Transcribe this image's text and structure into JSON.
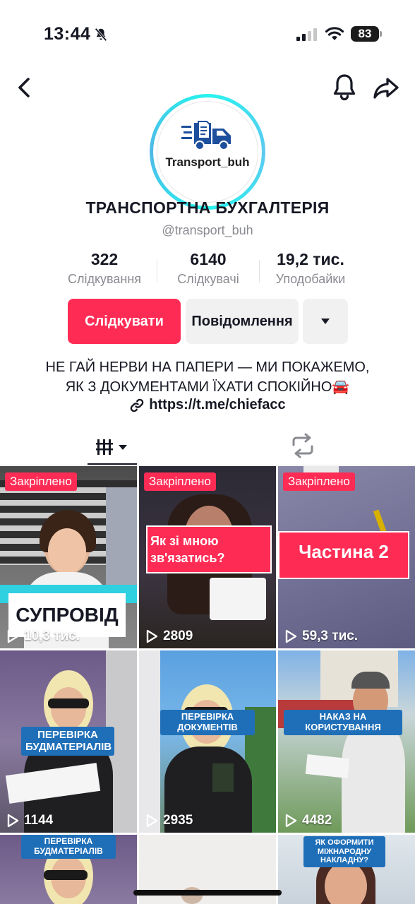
{
  "status_bar": {
    "time": "13:44",
    "battery": "83"
  },
  "profile": {
    "avatar_logo_text": "Transport_buh",
    "display_name": "ТРАНСПОРТНА БУХГАЛТЕРІЯ",
    "username": "@transport_buh",
    "stats": [
      {
        "value": "322",
        "label": "Слідкування"
      },
      {
        "value": "6140",
        "label": "Слідкувачі"
      },
      {
        "value": "19,2 тис.",
        "label": "Уподобайки"
      }
    ],
    "follow_label": "Слідкувати",
    "message_label": "Повідомлення",
    "bio_line1": "НЕ ГАЙ НЕРВИ НА ПАПЕРИ — МИ ПОКАЖЕМО,",
    "bio_line2": "ЯК З ДОКУМЕНТАМИ ЇХАТИ СПОКІЙНО🚘",
    "link": "https://t.me/chiefacc"
  },
  "videos": [
    {
      "pinned": "Закріплено",
      "caption": "СУПРОВІД",
      "views": "10,3 тис."
    },
    {
      "pinned": "Закріплено",
      "caption": "Як зі мною зв'язатись?",
      "views": "2809"
    },
    {
      "pinned": "Закріплено",
      "caption": "Частина 2",
      "views": "59,3 тис."
    },
    {
      "caption": "ПЕРЕВІРКА БУДМАТЕРІАЛІВ",
      "views": "1144"
    },
    {
      "caption": "ПЕРЕВІРКА ДОКУМЕНТІВ",
      "views": "2935"
    },
    {
      "caption": "НАКАЗ НА КОРИСТУВАННЯ",
      "views": "4482"
    },
    {
      "caption": "ПЕРЕВІРКА БУДМАТЕРІАЛІВ"
    },
    {
      "caption": ""
    },
    {
      "caption": "ЯК ОФОРМИТИ МІЖНАРОДНУ НАКЛАДНУ?"
    }
  ],
  "icons": [
    "back-icon",
    "bell-icon",
    "share-icon",
    "link-icon",
    "grid-icon",
    "repost-icon",
    "play-icon"
  ],
  "colors": {
    "accent": "#fe2c55",
    "secondary_button": "#f1f1f2",
    "caption_blue": "#1f6fb8"
  }
}
